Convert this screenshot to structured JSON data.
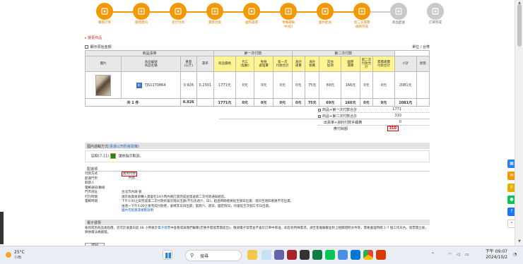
{
  "steps": [
    {
      "label": "購買訂單",
      "active": true,
      "icon": "cart-icon"
    },
    {
      "label": "驗證資訊",
      "active": true,
      "icon": "shield-icon"
    },
    {
      "label": "進行付款",
      "active": true,
      "icon": "card-icon"
    },
    {
      "label": "賣家出貨",
      "active": true,
      "icon": "box-icon"
    },
    {
      "label": "國際貨運",
      "active": true,
      "icon": "truck-icon"
    },
    {
      "label": "預備運輸\n中(結)",
      "active": true,
      "icon": "plane-icon"
    },
    {
      "label": "國內配送",
      "active": true,
      "icon": "delivery-icon"
    },
    {
      "label": "第二次運費\n補款完成",
      "active": true,
      "icon": "money-icon"
    },
    {
      "label": "商品配送",
      "active": false,
      "icon": "person-icon"
    },
    {
      "label": "訂單完成",
      "active": false,
      "icon": "check-icon"
    }
  ],
  "links": {
    "arrow": "▸",
    "change_record": "變更商品"
  },
  "subbar": {
    "checkbox_label": "顯示原始金額",
    "unit": "單位 / 台幣"
  },
  "table": {
    "group_product": "商品清單",
    "group_first": "第一次付款",
    "group_second": "第二次付款",
    "headers": [
      "圖片",
      "商品編號\n商品名稱",
      "重量\n(公斤)",
      "運率",
      "商品價格",
      "代工\n(點數)",
      "免稅\n處理費",
      "第一次\n付款合計",
      "海外\n運費",
      "海外\n稅費",
      "其他\n加項",
      "國際\n運費",
      "第二次\n付款合計",
      "累積運費\n付款合計",
      "小計",
      "狀態"
    ],
    "item": {
      "badge": "扣",
      "sku": "TJS1170864",
      "weight": "0.926",
      "rate": "0.2301",
      "price": "1771元",
      "c1": "0元",
      "c2": "0元",
      "c3": "0元",
      "c4": "0元",
      "c5": "75元",
      "c6": "69元",
      "c7": "166元",
      "c8": "0元",
      "c9": "0元",
      "subtotal": "2081元",
      "status": ""
    },
    "sum": {
      "label": "共 1 件",
      "weight": "0.926",
      "price": "1771元",
      "c1": "0元",
      "c2": "0元",
      "c3": "0元",
      "c4": "0元",
      "c5": "75元",
      "c6": "69元",
      "c7": "166元",
      "c8": "0元",
      "c9": "0元",
      "subtotal": "2081元"
    }
  },
  "totals": [
    {
      "label": "商品+第一次付款合計",
      "value": "1771",
      "icon": "plus-icon"
    },
    {
      "label": "商品+第二次付款合計",
      "value": "310",
      "icon": "plus-icon"
    },
    {
      "label": "出貨單+資料付款手續費",
      "value": "0",
      "icon": ""
    },
    {
      "label": "應付餘額",
      "value": "310",
      "icon": ""
    }
  ],
  "shipping": {
    "header": "國內運輸方式",
    "header_link": "(貨運公司防疫政策)",
    "method": "店取(7-11)",
    "method_note": "請依指示取貨。"
  },
  "delivery": {
    "header": "配運項",
    "rows": [
      {
        "k": "付款方式",
        "v": "貨到付款",
        "boxed": true
      },
      {
        "k": "配運門市",
        "v": "門市"
      },
      {
        "k": "取貨人",
        "v": ""
      },
      {
        "k": "電郵通知/聯絡",
        "v": ""
      },
      {
        "k": "門市地址",
        "v": "台北市內湖            號"
      },
      {
        "k": "打包時間",
        "v": "請於收貨後即轉入貨會在24小時內將訂貨完成並發送第二次付款通知給您。"
      },
      {
        "k": "電郵時間",
        "v": "下午3:00之前完成第二次付款的會於隔天出貨(不包含週六、日)，超過時間者將延至隔日出貨；週日至週四者將不可出貨。"
      },
      {
        "k": "",
        "v": "由週一下午3:00之後完成付款者，會將其日同出貨；當周六、週日、國定假日，均會延至次個工作日出貨。"
      },
      {
        "k": "",
        "v": "國內宅配貨運規劃說明",
        "link": true
      }
    ]
  },
  "einvoice": {
    "header": "電子發票",
    "text1": "收到或到商品後賠償，您可於收貨日起 48 小時後於",
    "link": "電子發票",
    "text2": "中查看或與我們聯繫(若要手開發票需提出)，敬請電子發票並不會於訂單中寄送，如您有特殊需求，請至客服聯繫並附上相關證明文件等，需要處理時間 2-7 個工作天內。發票開立後，將依循法規處理。"
  },
  "back_button": "返回",
  "taskbar": {
    "temp": "25°C",
    "weather": "小雨",
    "search": "搜尋",
    "time": "下午 09:07",
    "date": "2024/10/2"
  }
}
